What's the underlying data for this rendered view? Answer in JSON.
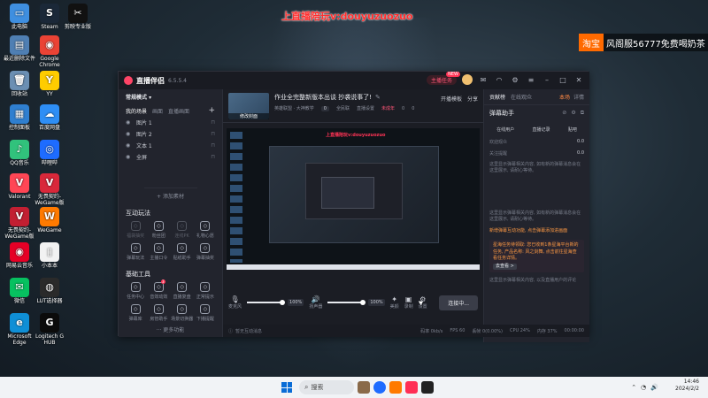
{
  "desktop": {
    "icons": [
      {
        "label": "此电脑",
        "glyph": "▭",
        "color": "#3f8fe0"
      },
      {
        "label": "Steam",
        "glyph": "S",
        "color": "#1b2838"
      },
      {
        "label": "剪映专业版",
        "glyph": "✂",
        "color": "#111111"
      },
      {
        "label": "最近删除文件",
        "glyph": "▤",
        "color": "#4f7fb3"
      },
      {
        "label": "Google Chrome",
        "glyph": "◉",
        "color": "#ea4335"
      },
      {
        "label": "回收站",
        "glyph": "🗑",
        "color": "#6b8fb3"
      },
      {
        "label": "YY",
        "glyph": "Y",
        "color": "#ffcc00"
      },
      {
        "label": "控制面板",
        "glyph": "▦",
        "color": "#2f7fd0"
      },
      {
        "label": "百度网盘",
        "glyph": "☁",
        "color": "#2e8ef5"
      },
      {
        "label": "QQ音乐",
        "glyph": "♪",
        "color": "#31c27c"
      },
      {
        "label": "哔哩哔",
        "glyph": "◎",
        "color": "#1e6cff"
      },
      {
        "label": "Valorant",
        "glyph": "V",
        "color": "#ff4655"
      },
      {
        "label": "无畏契约-WeGame版",
        "glyph": "V",
        "color": "#d9283a"
      },
      {
        "label": "无畏契约-WeGame版",
        "glyph": "V",
        "color": "#c21f32"
      },
      {
        "label": "WeGame",
        "glyph": "W",
        "color": "#ff7a00"
      },
      {
        "label": "网易云音乐",
        "glyph": "◉",
        "color": "#e60026"
      },
      {
        "label": "小本本",
        "glyph": "▯",
        "color": "#f2f2f2"
      },
      {
        "label": "微信",
        "glyph": "✉",
        "color": "#07c160"
      },
      {
        "label": "LUT选择器",
        "glyph": "◍",
        "color": "#2a2a2a"
      },
      {
        "label": "Microsoft Edge",
        "glyph": "e",
        "color": "#0f8fd6"
      },
      {
        "label": "Logitech G HUB",
        "glyph": "G",
        "color": "#0b0b0b"
      }
    ]
  },
  "overlay": {
    "stream_text": "上直播陪玩v:douyuzuozuo",
    "taobao_tag": "淘宝",
    "taobao_text": "风阁服56777免费喝奶茶"
  },
  "app": {
    "title": "直播伴侣",
    "version": "6.5.5.4",
    "live_button": "主播任务",
    "live_badge": "NEW",
    "scenes_label": "常规模式 ▾",
    "scene_tabs": [
      "横屏",
      "竖屏"
    ],
    "source_tabs": [
      "我的场景",
      "画面",
      "直播画面"
    ],
    "sources": [
      {
        "name": "图片 1"
      },
      {
        "name": "图片 2"
      },
      {
        "name": "文本 1"
      },
      {
        "name": "全屏"
      }
    ],
    "add_source": "+ 添加素材",
    "interact_title": "互动玩法",
    "interact_tools": [
      {
        "label": "福袋抽奖",
        "dim": true
      },
      {
        "label": "粉丝团",
        "dim": false
      },
      {
        "label": "连线PK",
        "dim": true
      },
      {
        "label": "礼物心愿",
        "dim": false
      },
      {
        "label": "弹幕玩法",
        "dim": false
      },
      {
        "label": "主播口令",
        "dim": false
      },
      {
        "label": "贴纸助手",
        "dim": false
      },
      {
        "label": "弹幕抽奖",
        "dim": false
      }
    ],
    "basic_title": "基础工具",
    "basic_tools": [
      {
        "label": "任务中心",
        "badge": ""
      },
      {
        "label": "音效动效",
        "badge": "3"
      },
      {
        "label": "直播复盘",
        "badge": ""
      },
      {
        "label": "正常提示",
        "badge": ""
      },
      {
        "label": "弹幕库",
        "badge": ""
      },
      {
        "label": "房管助手",
        "badge": ""
      },
      {
        "label": "场景切换器",
        "badge": ""
      },
      {
        "label": "下播提醒",
        "badge": ""
      }
    ],
    "more_functions": "··· 更多功能",
    "cover_label": "修改封面",
    "live_title": "作业全完整新版本出谈 抄袭说事了!",
    "live_title_edit": "✎",
    "head_actions": [
      "开播模板",
      "分享"
    ],
    "meta": {
      "category": "英雄联盟 · 大神教学",
      "quality": "全民联",
      "chip": "0",
      "setting": "直播设置",
      "timer": "未成年",
      "likes": "0",
      "viewers": "0"
    },
    "preview_redtext": "上直播陪玩v:douyuzuozuo",
    "mixer": {
      "mic_label": "麦克风",
      "mic_pct": "100%",
      "mic_level": 1.0,
      "speaker_label": "扬声器",
      "speaker_pct": "100%",
      "speaker_level": 1.0,
      "camera_label": "美颜",
      "record_label": "录制",
      "settings_label": "设置",
      "start_button": "连接中..."
    },
    "status": {
      "left": "暂无互动消息",
      "items": [
        "码率 0kb/s",
        "FPS 60",
        "丢帧 0(0.00%)",
        "CPU 24%",
        "内存 37%",
        "00:00:00"
      ]
    },
    "right_tabs": [
      "贡献榜",
      "在线观众",
      "榜单"
    ],
    "right_tab_hot": "本场",
    "right_tab_more": "详情",
    "assist_title": "弹幕助手",
    "assist_tabs": [
      "在线用户",
      "直播记录",
      "贴吧"
    ],
    "assist_rows": [
      {
        "label": "欢迎观众",
        "value": "0.0"
      },
      {
        "label": "关注提醒",
        "value": "0.0"
      }
    ],
    "messages": [
      {
        "text": "这里显示弹幕相关内容, 如有新的弹幕消息会在这里展示, 请耐心等待。",
        "kind": "normal"
      },
      {
        "text": "这里显示弹幕相关内容, 如有新的弹幕消息会在这里展示, 请耐心等待。",
        "kind": "normal"
      },
      {
        "text": "新增弹幕互动功能, 点击弹幕添加进画面",
        "kind": "orange"
      }
    ],
    "notice": "星海任务待领取: 您已收到1条星海平台新的任务, 产品名称: 风之剑舞, 点击前往星海查看任务详情。",
    "notice_btn": "去查看 >",
    "footer_msg": "这里显示弹幕相关内容, 以及直播用户的评论"
  },
  "taskbar": {
    "search_placeholder": "搜索",
    "time": "14:46",
    "date": "2024/2/2"
  }
}
